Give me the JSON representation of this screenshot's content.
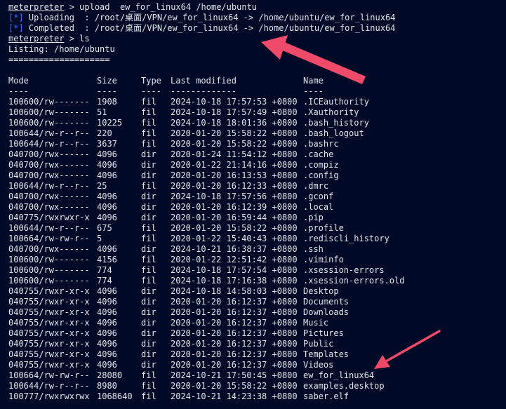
{
  "terminal": {
    "prompt": "meterpreter",
    "cmd_upload": " > upload  ew_for_linux64 /home/ubuntu",
    "tag_info": "[*]",
    "uploading": " Uploading  : /root/桌面/VPN/ew_for_linux64 -> /home/ubuntu/ew_for_linux64",
    "completed": " Completed  : /root/桌面/VPN/ew_for_linux64 -> /home/ubuntu/ew_for_linux64",
    "cmd_ls": " > ls",
    "listing": "Listing: /home/ubuntu",
    "separator": "====================",
    "headers": {
      "mode": "Mode",
      "size": "Size",
      "type": "Type",
      "modified": "Last modified",
      "name": "Name"
    },
    "dashes": {
      "mode": "----",
      "size": "----",
      "type": "----",
      "modified": "-------------",
      "name": "----"
    },
    "rows": [
      {
        "mode": "100600/rw-------",
        "size": "1908",
        "type": "fil",
        "modified": "2024-10-18 17:57:53 +0800",
        "name": ".ICEauthority"
      },
      {
        "mode": "100600/rw-------",
        "size": "51",
        "type": "fil",
        "modified": "2024-10-18 17:57:49 +0800",
        "name": ".Xauthority"
      },
      {
        "mode": "100600/rw-------",
        "size": "10225",
        "type": "fil",
        "modified": "2024-10-18 18:01:36 +0800",
        "name": ".bash_history"
      },
      {
        "mode": "100644/rw-r--r--",
        "size": "220",
        "type": "fil",
        "modified": "2020-01-20 15:58:22 +0800",
        "name": ".bash_logout"
      },
      {
        "mode": "100644/rw-r--r--",
        "size": "3637",
        "type": "fil",
        "modified": "2020-01-20 15:58:22 +0800",
        "name": ".bashrc"
      },
      {
        "mode": "040700/rwx------",
        "size": "4096",
        "type": "dir",
        "modified": "2020-01-24 11:54:12 +0800",
        "name": ".cache"
      },
      {
        "mode": "040700/rwx------",
        "size": "4096",
        "type": "dir",
        "modified": "2020-01-22 21:14:16 +0800",
        "name": ".compiz"
      },
      {
        "mode": "040700/rwx------",
        "size": "4096",
        "type": "dir",
        "modified": "2020-01-20 16:13:53 +0800",
        "name": ".config"
      },
      {
        "mode": "100644/rw-r--r--",
        "size": "25",
        "type": "fil",
        "modified": "2020-01-20 16:12:33 +0800",
        "name": ".dmrc"
      },
      {
        "mode": "040700/rwx------",
        "size": "4096",
        "type": "dir",
        "modified": "2024-10-18 17:57:56 +0800",
        "name": ".gconf"
      },
      {
        "mode": "040700/rwx------",
        "size": "4096",
        "type": "dir",
        "modified": "2020-01-20 16:12:39 +0800",
        "name": ".local"
      },
      {
        "mode": "040775/rwxrwxr-x",
        "size": "4096",
        "type": "dir",
        "modified": "2020-01-20 16:59:44 +0800",
        "name": ".pip"
      },
      {
        "mode": "100644/rw-r--r--",
        "size": "675",
        "type": "fil",
        "modified": "2020-01-20 15:58:22 +0800",
        "name": ".profile"
      },
      {
        "mode": "100664/rw-rw-r--",
        "size": "5",
        "type": "fil",
        "modified": "2020-01-22 15:40:43 +0800",
        "name": ".rediscli_history"
      },
      {
        "mode": "040700/rwx------",
        "size": "4096",
        "type": "dir",
        "modified": "2024-10-21 16:38:37 +0800",
        "name": ".ssh"
      },
      {
        "mode": "100600/rw-------",
        "size": "4156",
        "type": "fil",
        "modified": "2020-01-22 12:51:42 +0800",
        "name": ".viminfo"
      },
      {
        "mode": "100600/rw-------",
        "size": "774",
        "type": "fil",
        "modified": "2024-10-18 17:57:54 +0800",
        "name": ".xsession-errors"
      },
      {
        "mode": "100600/rw-------",
        "size": "774",
        "type": "fil",
        "modified": "2024-10-18 17:16:38 +0800",
        "name": ".xsession-errors.old"
      },
      {
        "mode": "040755/rwxr-xr-x",
        "size": "4096",
        "type": "dir",
        "modified": "2024-10-18 14:58:03 +0800",
        "name": "Desktop"
      },
      {
        "mode": "040755/rwxr-xr-x",
        "size": "4096",
        "type": "dir",
        "modified": "2020-01-20 16:12:37 +0800",
        "name": "Documents"
      },
      {
        "mode": "040755/rwxr-xr-x",
        "size": "4096",
        "type": "dir",
        "modified": "2020-01-20 16:12:37 +0800",
        "name": "Downloads"
      },
      {
        "mode": "040755/rwxr-xr-x",
        "size": "4096",
        "type": "dir",
        "modified": "2020-01-20 16:12:37 +0800",
        "name": "Music"
      },
      {
        "mode": "040755/rwxr-xr-x",
        "size": "4096",
        "type": "dir",
        "modified": "2020-01-20 16:12:37 +0800",
        "name": "Pictures"
      },
      {
        "mode": "040755/rwxr-xr-x",
        "size": "4096",
        "type": "dir",
        "modified": "2020-01-20 16:12:37 +0800",
        "name": "Public"
      },
      {
        "mode": "040755/rwxr-xr-x",
        "size": "4096",
        "type": "dir",
        "modified": "2020-01-20 16:12:37 +0800",
        "name": "Templates"
      },
      {
        "mode": "040755/rwxr-xr-x",
        "size": "4096",
        "type": "dir",
        "modified": "2020-01-20 16:12:37 +0800",
        "name": "Videos"
      },
      {
        "mode": "100664/rw-rw-r--",
        "size": "28080",
        "type": "fil",
        "modified": "2024-10-21 17:50:45 +0800",
        "name": "ew_for_linux64"
      },
      {
        "mode": "100644/rw-r--r--",
        "size": "8980",
        "type": "fil",
        "modified": "2020-01-20 15:58:22 +0800",
        "name": "examples.desktop"
      },
      {
        "mode": "100777/rwxrwxrwx",
        "size": "1068640",
        "type": "fil",
        "modified": "2024-10-21 14:23:38 +0800",
        "name": "saber.elf"
      }
    ]
  },
  "colors": {
    "background": "#000a26",
    "text": "#e4e6ee",
    "info_tag": "#3b6cff",
    "annotation_arrow": "#f04a6a"
  }
}
